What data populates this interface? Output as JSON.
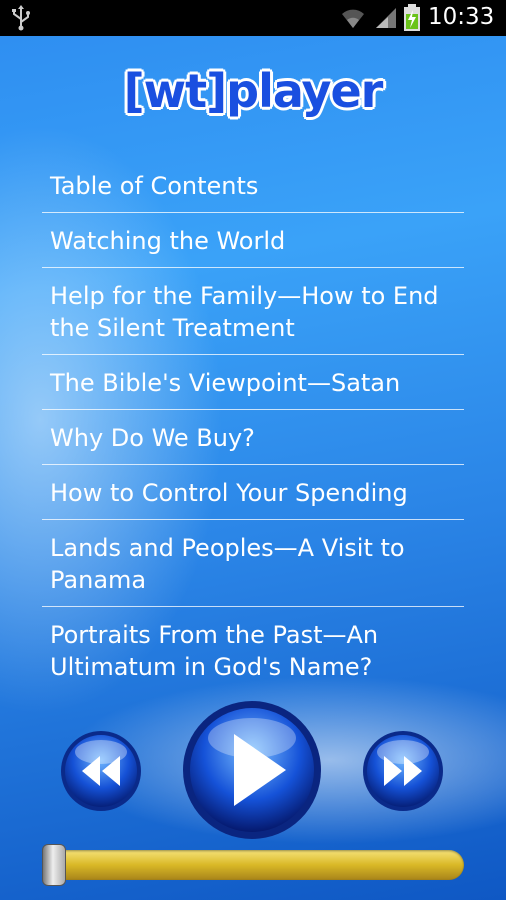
{
  "status_bar": {
    "time": "10:33",
    "icons": [
      "usb-icon",
      "wifi-icon",
      "signal-icon",
      "battery-charging-icon"
    ]
  },
  "app": {
    "logo_text": "[wt]player"
  },
  "toc": {
    "items": [
      "Table of Contents",
      "Watching the World",
      "Help for the Family—How to End the Silent Treatment",
      "The Bible's Viewpoint—Satan",
      "Why Do We Buy?",
      "How to Control Your Spending",
      "Lands and Peoples—A Visit to Panama",
      "Portraits From the Past—An Ultimatum in God's Name?"
    ]
  },
  "player": {
    "buttons": [
      "rewind-icon",
      "play-icon",
      "fast-forward-icon"
    ],
    "progress": 0.0
  }
}
